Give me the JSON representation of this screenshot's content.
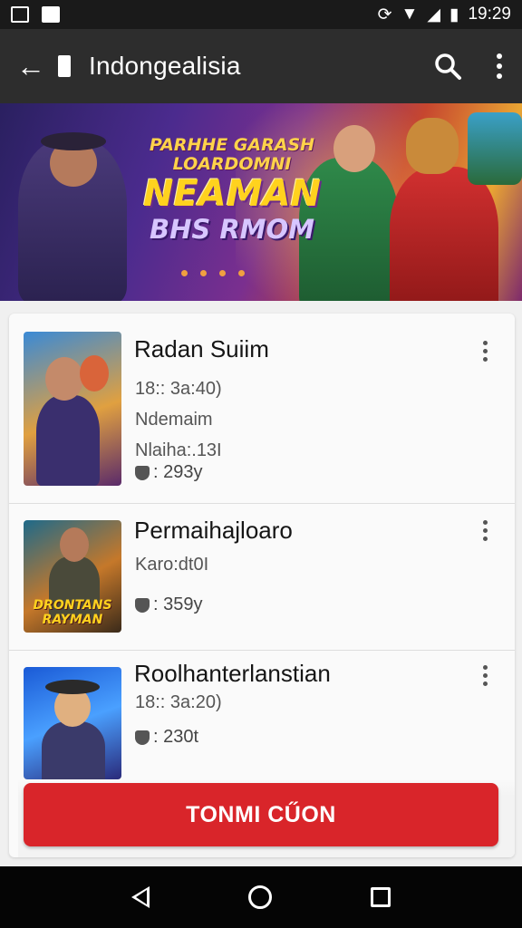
{
  "status_bar": {
    "time": "19:29",
    "icons": [
      "image-icon",
      "message-icon",
      "alarm-icon",
      "wifi-icon",
      "signal-icon",
      "battery-icon"
    ]
  },
  "app_bar": {
    "title": "Indongealisia",
    "icons": [
      "back-arrow-icon",
      "document-icon",
      "search-icon",
      "more-vert-icon"
    ]
  },
  "banner": {
    "line1": "PARHHE GARASH",
    "line2": "LOARDOMNI",
    "line3": "NEAMAN",
    "line4": "BHS RMOM",
    "dots": 4
  },
  "list": [
    {
      "name": "Radan Suiim",
      "meta": [
        "18:: 3a:40)",
        "Ndemaim",
        "Nlaiha:.13I"
      ],
      "rating": ": 293y",
      "thumb_caption": ""
    },
    {
      "name": "Permaihajloaro",
      "meta": [
        "Karo:dt0I"
      ],
      "rating": ": 359y",
      "thumb_caption": "DRONTANS RAYMAN"
    },
    {
      "name": "Roolhanterlanstian",
      "meta": [
        "18:: 3a:20)"
      ],
      "rating": ": 230t",
      "thumb_caption": ""
    }
  ],
  "cta": {
    "label": "TONMI CŰON"
  },
  "colors": {
    "cta": "#d9252a",
    "app_bar": "#2d2d2d",
    "status_bar": "#1a1a1a"
  }
}
